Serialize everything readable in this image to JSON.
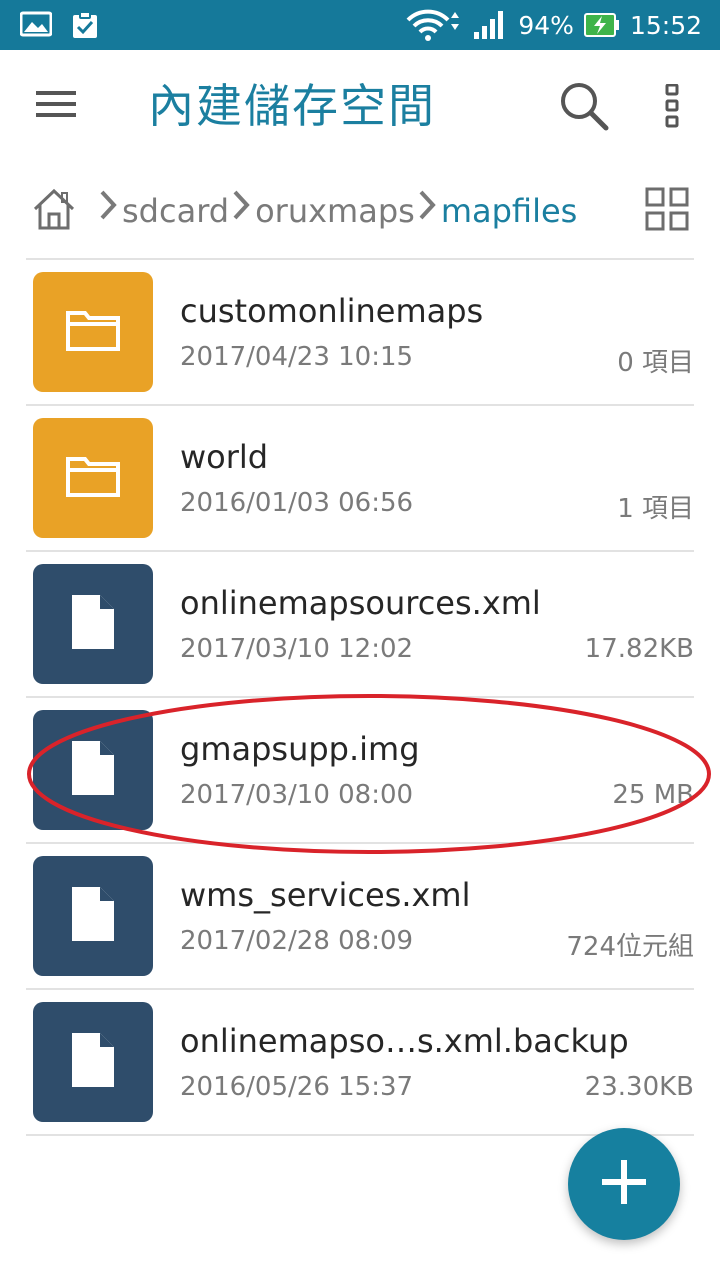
{
  "status_bar": {
    "battery": "94%",
    "time": "15:52",
    "icons": [
      "gallery-icon",
      "clipboard-check-icon",
      "wifi-icon",
      "signal-icon",
      "battery-charging-icon"
    ]
  },
  "app_bar": {
    "title": "內建儲存空間",
    "icons": [
      "menu-icon",
      "search-icon",
      "more-vert-icon"
    ]
  },
  "breadcrumb": {
    "items": [
      "sdcard",
      "oruxmaps",
      "mapfiles"
    ],
    "active_index": 2
  },
  "files": [
    {
      "type": "folder",
      "name": "customonlinemaps",
      "date": "2017/04/23 10:15",
      "size": "0 項目"
    },
    {
      "type": "folder",
      "name": "world",
      "date": "2016/01/03 06:56",
      "size": "1 項目"
    },
    {
      "type": "file",
      "name": "onlinemapsources.xml",
      "date": "2017/03/10 12:02",
      "size": "17.82KB"
    },
    {
      "type": "file",
      "name": "gmapsupp.img",
      "date": "2017/03/10 08:00",
      "size": "25  MB"
    },
    {
      "type": "file",
      "name": "wms_services.xml",
      "date": "2017/02/28 08:09",
      "size": "724位元組"
    },
    {
      "type": "file",
      "name": "onlinemapso…s.xml.backup",
      "date": "2016/05/26 15:37",
      "size": "23.30KB"
    }
  ],
  "colors": {
    "status_bar": "#15799a",
    "accent": "#1b7fa0",
    "folder": "#e9a226",
    "file": "#2f4d6b",
    "annotation": "#d9232a"
  }
}
